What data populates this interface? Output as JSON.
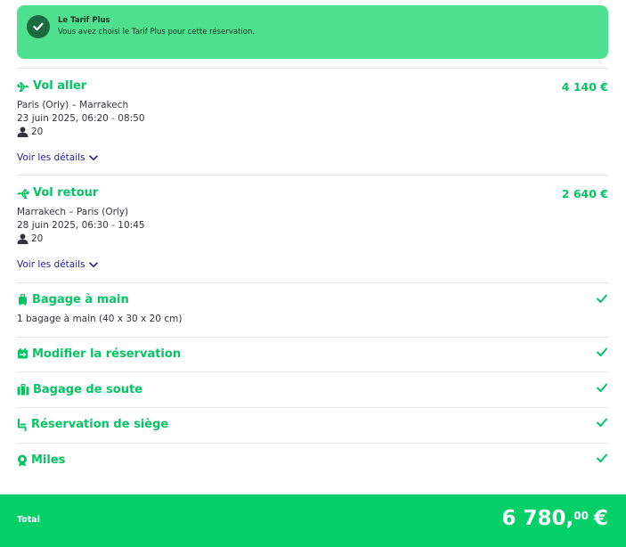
{
  "banner": {
    "title": "Le Tarif Plus",
    "subtitle": "Vous avez choisi le Tarif Plus pour cette réservation."
  },
  "outbound": {
    "title": "Vol aller",
    "price": "4 140 €",
    "route": "Paris (Orly) – Marrakech",
    "datetime": "23 juin 2025, 06:20 - 08:50",
    "passengers": "20",
    "details_link": "Voir les détails"
  },
  "return": {
    "title": "Vol retour",
    "price": "2 640 €",
    "route": "Marrakech – Paris (Orly)",
    "datetime": "28 juin 2025, 06:30 - 10:45",
    "passengers": "20",
    "details_link": "Voir les détails"
  },
  "features": [
    {
      "title": "Bagage à main",
      "description": "1 bagage à main (40 x 30 x 20 cm)",
      "icon": "hand-baggage-icon"
    },
    {
      "title": "Modifier la réservation",
      "icon": "modify-booking-icon"
    },
    {
      "title": "Bagage de soute",
      "icon": "checked-baggage-icon"
    },
    {
      "title": "Réservation de siège",
      "icon": "seat-icon"
    },
    {
      "title": "Miles",
      "icon": "miles-icon"
    }
  ],
  "total": {
    "label": "Total",
    "amount_main": "6 780,",
    "amount_cents": "00",
    "currency": "€"
  },
  "colors": {
    "accent": "#05c463",
    "banner": "#4fe08f",
    "total_bar": "#04cf68",
    "link": "#1f1f8f"
  }
}
